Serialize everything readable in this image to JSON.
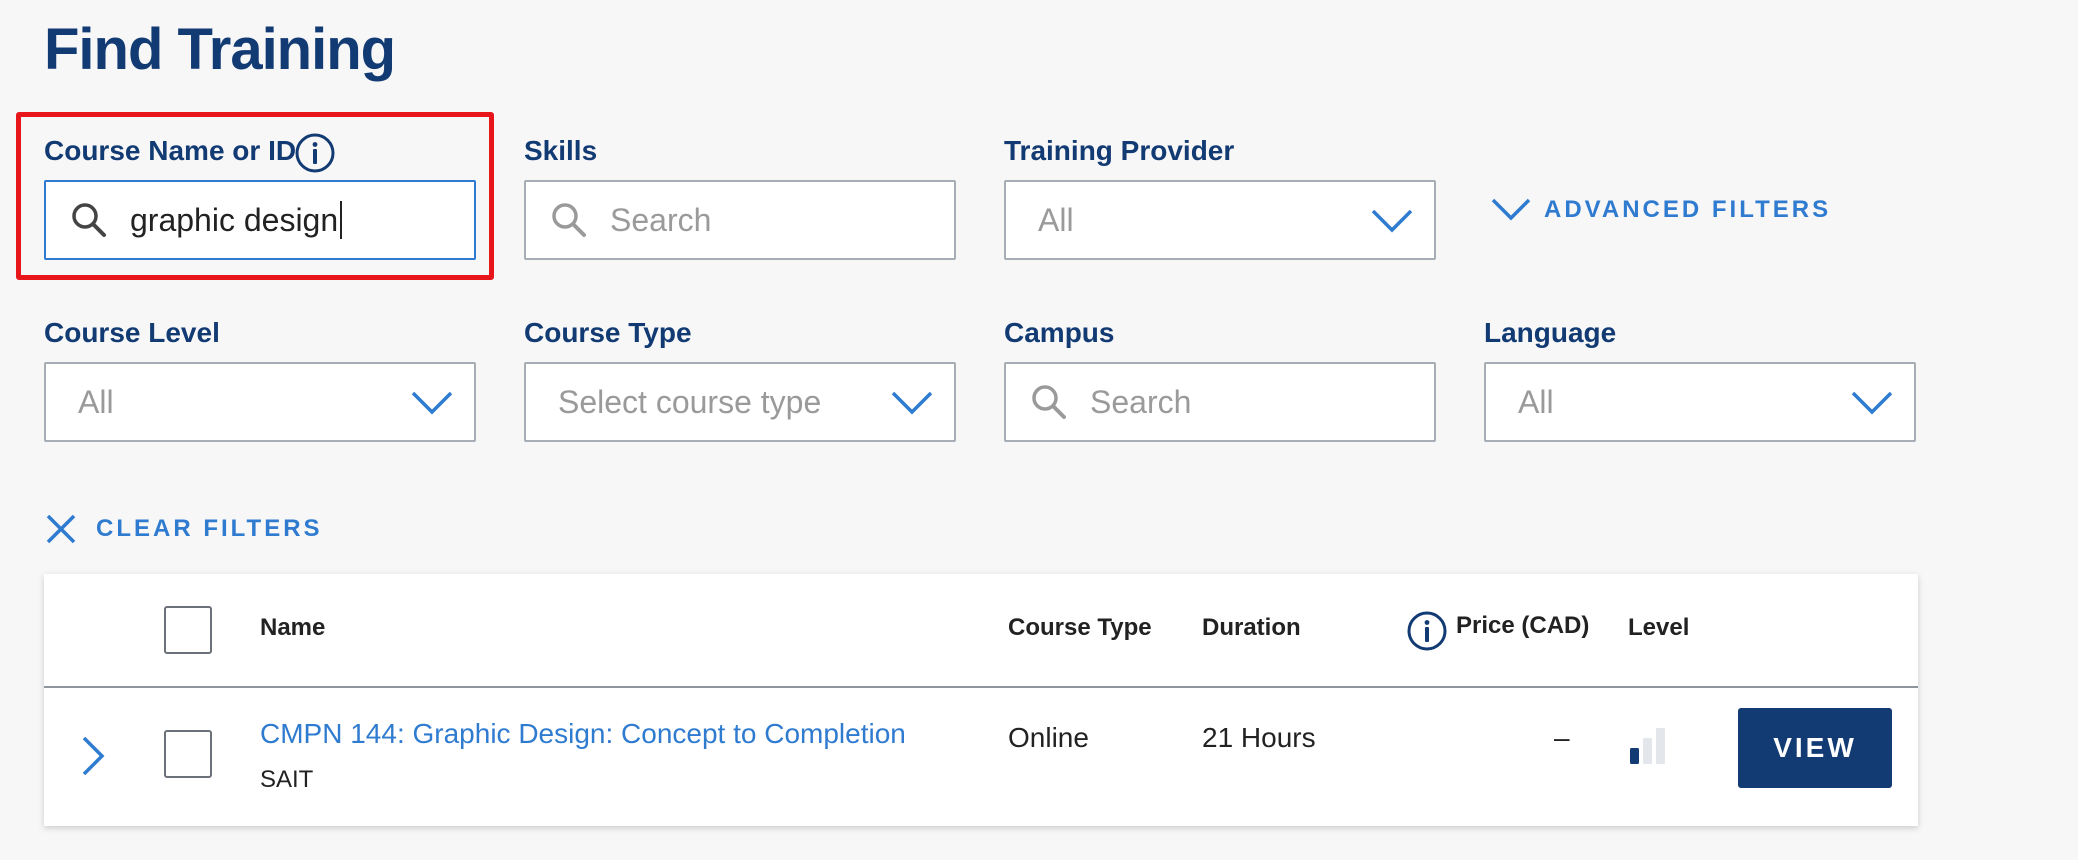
{
  "page": {
    "title": "Find Training"
  },
  "filters": {
    "course_name": {
      "label": "Course Name or ID",
      "value": "graphic design",
      "icon": "search-icon",
      "info_icon": "info-icon"
    },
    "skills": {
      "label": "Skills",
      "placeholder": "Search",
      "icon": "search-icon"
    },
    "training_provider": {
      "label": "Training Provider",
      "value": "All",
      "icon": "chevron-down-icon"
    },
    "advanced_filters": {
      "label": "ADVANCED FILTERS",
      "icon": "chevron-down-icon"
    },
    "course_level": {
      "label": "Course Level",
      "value": "All"
    },
    "course_type": {
      "label": "Course Type",
      "placeholder": "Select course type"
    },
    "campus": {
      "label": "Campus",
      "placeholder": "Search"
    },
    "language": {
      "label": "Language",
      "value": "All"
    },
    "clear_filters": {
      "label": "CLEAR FILTERS",
      "icon": "close-icon"
    }
  },
  "table": {
    "columns": {
      "name": "Name",
      "course_type": "Course Type",
      "duration": "Duration",
      "price": "Price (CAD)",
      "level": "Level"
    },
    "rows": [
      {
        "name": "CMPN 144: Graphic Design: Concept to Completion",
        "provider": "SAIT",
        "course_type": "Online",
        "duration": "21 Hours",
        "price": "–",
        "level": {
          "filled": 1,
          "total": 3
        },
        "action": "VIEW"
      }
    ]
  },
  "colors": {
    "brand_navy": "#123a73",
    "link_blue": "#2f7bd0",
    "highlight_red": "#e8161b"
  }
}
